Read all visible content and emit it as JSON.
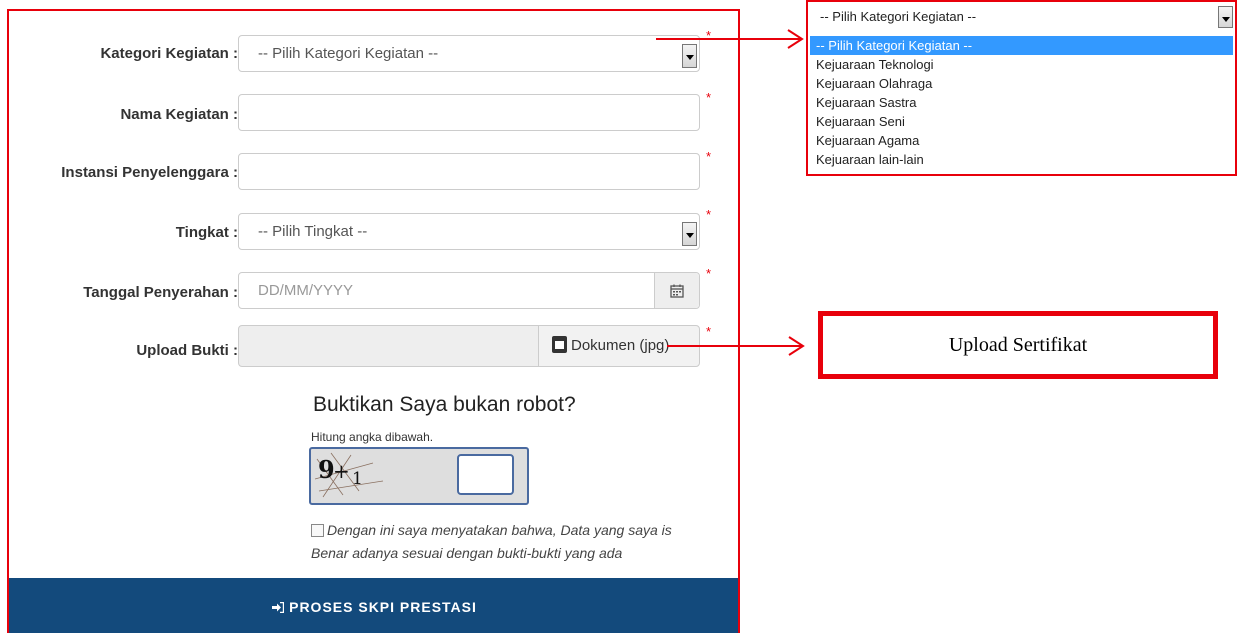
{
  "form": {
    "kategori": {
      "label": "Kategori Kegiatan :",
      "value": "-- Pilih Kategori Kegiatan --"
    },
    "nama": {
      "label": "Nama Kegiatan :",
      "value": ""
    },
    "instansi": {
      "label": "Instansi Penyelenggara :",
      "value": ""
    },
    "tingkat": {
      "label": "Tingkat :",
      "value": "-- Pilih Tingkat --"
    },
    "tanggal": {
      "label": "Tanggal Penyerahan :",
      "placeholder": "DD/MM/YYYY"
    },
    "upload": {
      "label": "Upload Bukti :",
      "button_label": "Dokumen (jpg)"
    },
    "required_mark": "*"
  },
  "captcha": {
    "title": "Buktikan Saya bukan robot?",
    "hint": "Hitung angka dibawah.",
    "digit_a": "9",
    "operator": "+",
    "digit_b": "1",
    "answer": ""
  },
  "agreement": {
    "line1": "Dengan ini saya menyatakan bahwa, Data yang saya is",
    "line2": "Benar adanya sesuai dengan bukti-bukti yang ada",
    "checked": false
  },
  "submit": {
    "label": "PROSES SKPI PRESTASI",
    "icon": "sign-in-icon"
  },
  "dropdown_callout": {
    "selected": "-- Pilih Kategori Kegiatan --",
    "options": [
      "-- Pilih Kategori Kegiatan --",
      "Kejuaraan Teknologi",
      "Kejuaraan Olahraga",
      "Kejuaraan Sastra",
      "Kejuaraan Seni",
      "Kejuaraan Agama",
      "Kejuaraan lain-lain"
    ]
  },
  "upload_callout": {
    "label": "Upload Sertifikat"
  },
  "colors": {
    "annotation_red": "#e8000b",
    "submit_bg": "#134a7c",
    "selected_option": "#3399ff"
  }
}
